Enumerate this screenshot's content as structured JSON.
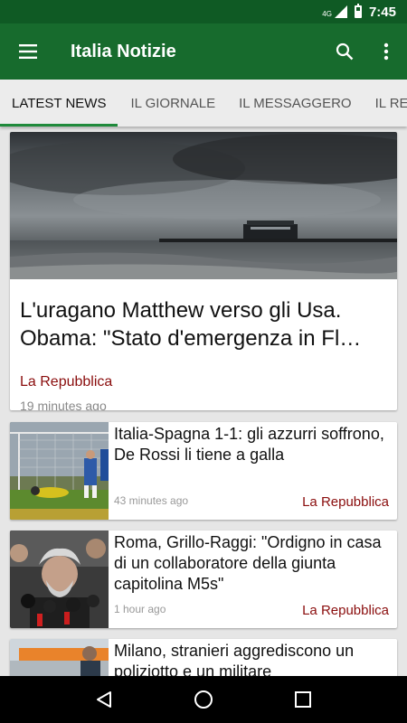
{
  "status_bar": {
    "network": "4G",
    "battery_level": 0.6,
    "time": "7:45"
  },
  "app_bar": {
    "title": "Italia Notizie",
    "menu_icon": "hamburger-menu-icon",
    "search_icon": "search-icon",
    "overflow_icon": "more-vert-icon"
  },
  "tabs": [
    {
      "label": "LATEST NEWS",
      "active": true
    },
    {
      "label": "IL GIORNALE",
      "active": false
    },
    {
      "label": "IL MESSAGGERO",
      "active": false
    },
    {
      "label": "IL RESTO DEL CARLINO",
      "active": false
    }
  ],
  "featured": {
    "title": "L'uragano Matthew verso gli Usa. Obama: \"Stato d'emergenza in Fl…",
    "source": "La Repubblica",
    "time": "19 minutes ago"
  },
  "articles": [
    {
      "title": "Italia-Spagna 1-1: gli azzurri soffrono, De Rossi li tiene a galla",
      "time": "43 minutes ago",
      "source": "La Repubblica"
    },
    {
      "title": "Roma, Grillo-Raggi: \"Ordigno in casa di un collaboratore della giunta capitolina M5s\"",
      "time": "1 hour ago",
      "source": "La Repubblica"
    },
    {
      "title": "Milano, stranieri aggrediscono un poliziotto e un militare",
      "time": "",
      "source": ""
    }
  ],
  "colors": {
    "status_bar": "#0f5a24",
    "app_bar": "#176b2d",
    "tab_indicator": "#1f8a3b",
    "source_text": "#8a0d0d"
  },
  "nav_bar": {
    "back_icon": "back-icon",
    "home_icon": "home-icon",
    "recents_icon": "recents-icon"
  }
}
